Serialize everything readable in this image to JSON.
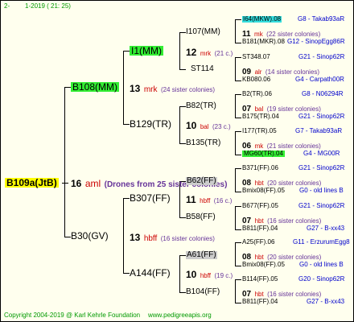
{
  "header": {
    "generation": "2-",
    "date_range": "1-2019 ( 21:  25)"
  },
  "footer": {
    "copyright": "Copyright 2004-2019 @ Karl Kehrle Foundation",
    "website": "www.pedigreeapis.org"
  },
  "root": {
    "id": "B109a(JtB)",
    "year": "16",
    "breeder": "aml",
    "note": "(Drones from 25 sister colonies)"
  },
  "gen1": [
    {
      "id": "B108(MM)",
      "year": "13",
      "breeder": "mrk",
      "sisters": "(24 sister colonies)"
    },
    {
      "id": "B30(GV)",
      "year": "13",
      "breeder": "hbff",
      "sisters": "(16 sister colonies)"
    }
  ],
  "gen2": [
    {
      "id": "I1(MM)",
      "year": "12",
      "breeder": "mrk",
      "sisters": "(21 c.)"
    },
    {
      "id": "B129(TR)",
      "year": "10",
      "breeder": "bal",
      "sisters": "(23 c.)"
    },
    {
      "id": "B307(FF)",
      "year": "11",
      "breeder": "hbff",
      "sisters": "(16 c.)"
    },
    {
      "id": "A144(FF)",
      "year": "10",
      "breeder": "hbff",
      "sisters": "(19 c.)"
    }
  ],
  "gen3": [
    {
      "id": "I107(MM)"
    },
    {
      "id": "ST114"
    },
    {
      "id": "B82(TR)"
    },
    {
      "id": "B135(TR)"
    },
    {
      "id": "B62(FF)"
    },
    {
      "id": "B58(FF)"
    },
    {
      "id": "A61(FF)"
    },
    {
      "id": "B104(FF)"
    }
  ],
  "gen4": [
    {
      "id": "I64(MKW).08",
      "label": "G8 - Takab93aR"
    },
    {
      "year": "11",
      "breeder": "mk",
      "sisters": "(22 sister colonies)"
    },
    {
      "id": "B181(MKR).08",
      "label": "G12 - SinopEgg86R"
    },
    {
      "id": "ST348.07",
      "label": "G21 - Sinop62R"
    },
    {
      "year": "09",
      "breeder": "alr",
      "sisters": "(14 sister colonies)"
    },
    {
      "id": "KB080.06",
      "label": "G4 - Carpath00R"
    },
    {
      "id": "B2(TR).06",
      "label": "G8 - N06294R"
    },
    {
      "year": "07",
      "breeder": "bal",
      "sisters": "(19 sister colonies)"
    },
    {
      "id": "B175(TR).04",
      "label": "G21 - Sinop62R"
    },
    {
      "id": "I177(TR).05",
      "label": "G7 - Takab93aR"
    },
    {
      "year": "06",
      "breeder": "mk",
      "sisters": "(21 sister colonies)"
    },
    {
      "id": "MG60(TR).04",
      "label": "G4 - MG00R"
    },
    {
      "id": "B371(FF).06",
      "label": "G21 - Sinop62R"
    },
    {
      "year": "08",
      "breeder": "hbt",
      "sisters": "(20 sister colonies)"
    },
    {
      "id": "Bmix08(FF).05",
      "label": "G0 - old lines B"
    },
    {
      "id": "B677(FF).05",
      "label": "G21 - Sinop62R"
    },
    {
      "year": "07",
      "breeder": "hbt",
      "sisters": "(16 sister colonies)"
    },
    {
      "id": "B811(FF).04",
      "label": "G27 - B-xx43"
    },
    {
      "id": "A25(FF).06",
      "label": "G11 - ErzurumEgg8"
    },
    {
      "year": "08",
      "breeder": "hbt",
      "sisters": "(20 sister colonies)"
    },
    {
      "id": "Bmix08(FF).05",
      "label": "G0 - old lines B"
    },
    {
      "id": "B114(FF).05",
      "label": "G20 - Sinop62R"
    },
    {
      "year": "07",
      "breeder": "hbt",
      "sisters": "(16 sister colonies)"
    },
    {
      "id": "B811(FF).04",
      "label": "G27 - B-xx43"
    }
  ]
}
